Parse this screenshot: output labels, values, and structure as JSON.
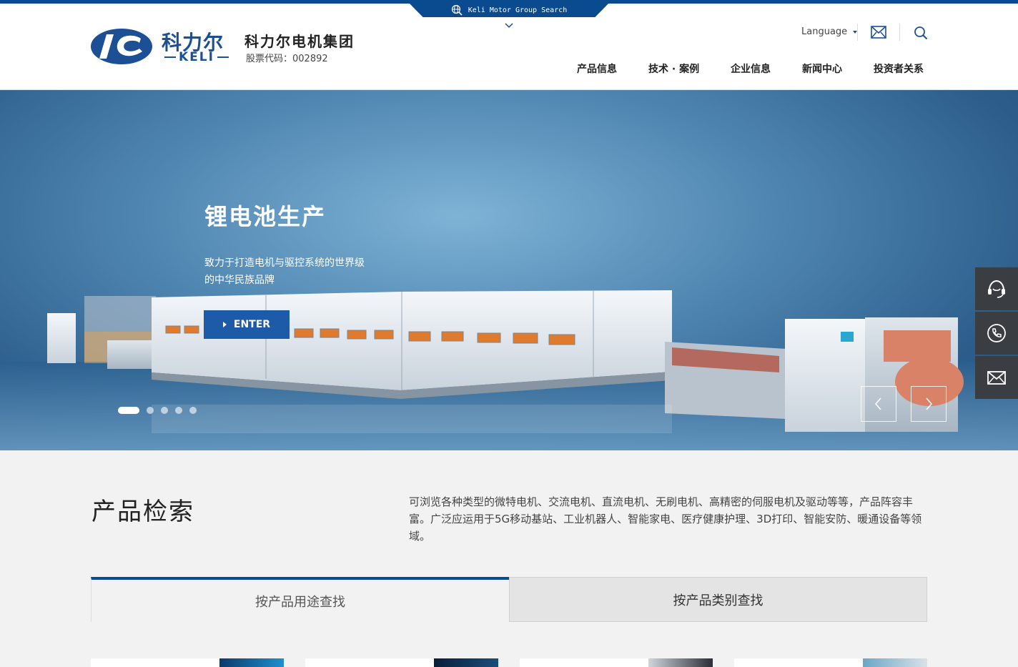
{
  "header": {
    "search_tab_label": "Keli Motor Group Search",
    "logo_cn": "科力尔",
    "logo_en": "KELI",
    "group_name": "科力尔电机集团",
    "stock_code": "股票代码：002892",
    "language_label": "Language",
    "nav": [
      {
        "label": "产品信息"
      },
      {
        "label": "技术 · 案例"
      },
      {
        "label": "企业信息"
      },
      {
        "label": "新闻中心"
      },
      {
        "label": "投资者关系"
      }
    ]
  },
  "banner": {
    "title": "锂电池生产",
    "subtitle": "致力于打造电机与驱控系统的世界级的中华民族品牌",
    "enter_label": "ENTER",
    "active_slide": 1,
    "slide_count": 5
  },
  "product_search": {
    "title": "产品检索",
    "description": "可浏览各种类型的微特电机、交流电机、直流电机、无刷电机、高精密的伺服电机及驱动等等，产品阵容丰富。广泛应运用于5G移动基站、工业机器人、智能家电、医疗健康护理、3D打印、智能安防、暖通设备等领域。",
    "tabs": [
      {
        "label": "按产品用途查找",
        "active": true
      },
      {
        "label": "按产品类别查找",
        "active": false
      }
    ]
  },
  "side_tools": [
    "headset-icon",
    "phone-icon",
    "mail-icon"
  ],
  "colors": {
    "brand": "#0a4a8f",
    "accent": "#1d5aa7"
  }
}
